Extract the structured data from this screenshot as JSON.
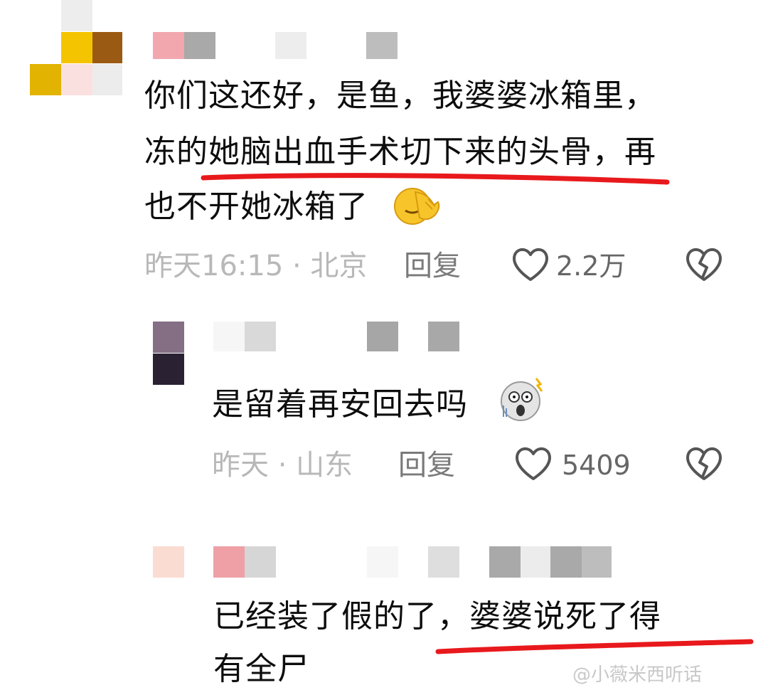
{
  "comments": [
    {
      "text_lines": [
        "你们这还好，是鱼，我婆婆冰箱里，",
        "冻的她脑出血手术切下来的头骨，再",
        "也不开她冰箱了"
      ],
      "emoji": "face-palm",
      "meta": "昨天16:15 · 北京",
      "reply_label": "回复",
      "likes": "2.2万"
    },
    {
      "text_lines": [
        "是留着再安回去吗"
      ],
      "emoji": "shocked-face",
      "meta": "昨天 · 山东",
      "reply_label": "回复",
      "likes": "5409"
    },
    {
      "text_lines": [
        "已经装了假的了，婆婆说死了得",
        "有全尸"
      ]
    }
  ],
  "watermark": "@小薇米西听话",
  "colors": {
    "underline": "#e8191c",
    "meta_text": "#b8b8b8",
    "reply_text": "#7a7a7a",
    "icon_stroke": "#555555"
  },
  "icons": [
    "heart-outline-icon",
    "broken-heart-icon"
  ]
}
